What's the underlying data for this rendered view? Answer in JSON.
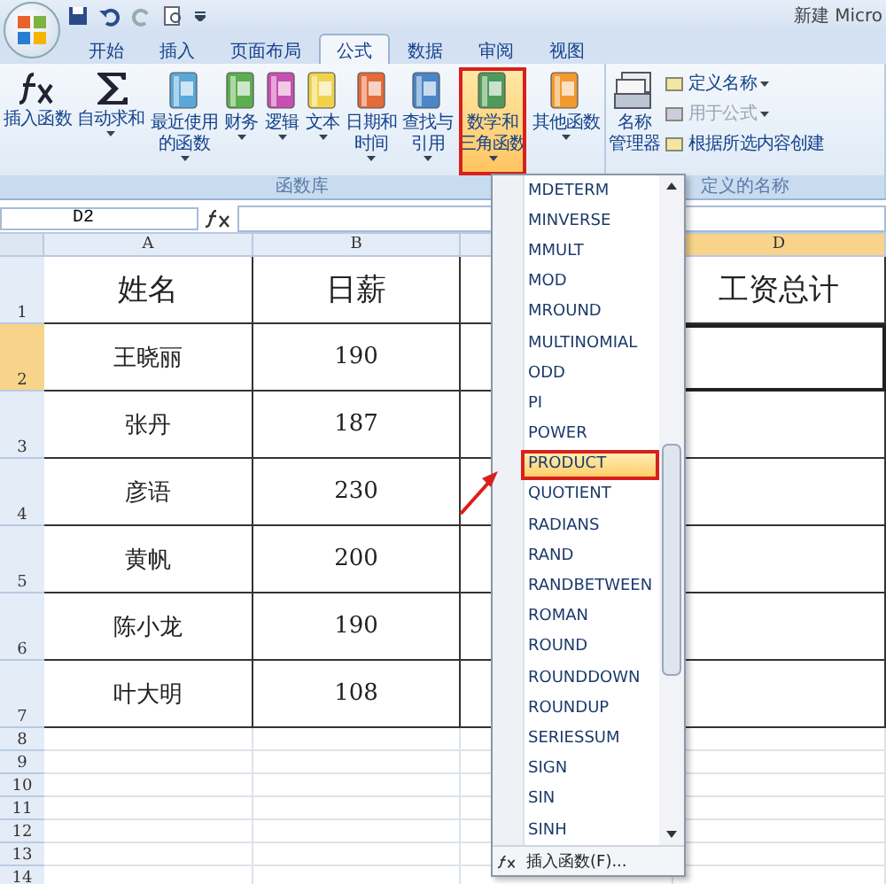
{
  "window": {
    "title": "新建 Micro"
  },
  "tabs": [
    {
      "label": "开始",
      "selected": false
    },
    {
      "label": "插入",
      "selected": false
    },
    {
      "label": "页面布局",
      "selected": false
    },
    {
      "label": "公式",
      "selected": true
    },
    {
      "label": "数据",
      "selected": false
    },
    {
      "label": "审阅",
      "selected": false
    },
    {
      "label": "视图",
      "selected": false
    }
  ],
  "ribbon": {
    "groups": [
      {
        "label": "函数库",
        "buttons": [
          {
            "kind": "fx",
            "lines": [
              "插入函数"
            ],
            "dropdown": false,
            "selected": false
          },
          {
            "kind": "sigma",
            "lines": [
              "自动求和"
            ],
            "dropdown": true,
            "selected": false
          },
          {
            "kind": "book",
            "color": "#5aa8d8",
            "lines": [
              "最近使用",
              "的函数"
            ],
            "dropdown": true,
            "selected": false
          },
          {
            "kind": "book",
            "color": "#5cae4e",
            "lines": [
              "财务"
            ],
            "dropdown": true,
            "selected": false
          },
          {
            "kind": "book",
            "color": "#c84fb0",
            "lines": [
              "逻辑"
            ],
            "dropdown": true,
            "selected": false
          },
          {
            "kind": "book",
            "color": "#f0d34a",
            "lines": [
              "文本"
            ],
            "dropdown": true,
            "selected": false
          },
          {
            "kind": "book",
            "color": "#e46a3a",
            "lines": [
              "日期和",
              "时间"
            ],
            "dropdown": true,
            "selected": false
          },
          {
            "kind": "book",
            "color": "#4a86c8",
            "lines": [
              "查找与",
              "引用"
            ],
            "dropdown": true,
            "selected": false
          },
          {
            "kind": "book",
            "color": "#4f9a5a",
            "lines": [
              "数学和",
              "三角函数"
            ],
            "dropdown": true,
            "selected": true
          },
          {
            "kind": "book",
            "color": "#f09a30",
            "lines": [
              "其他函数"
            ],
            "dropdown": true,
            "selected": false
          }
        ]
      },
      {
        "label": "定义的名称",
        "buttons": [
          {
            "kind": "cards",
            "lines": [
              "名称",
              "管理器"
            ],
            "dropdown": false,
            "selected": false
          }
        ],
        "small": [
          {
            "label": "定义名称",
            "dropdown": true,
            "disabled": false
          },
          {
            "label": "用于公式",
            "dropdown": true,
            "disabled": true
          },
          {
            "label": "根据所选内容创建",
            "dropdown": false,
            "disabled": false
          }
        ]
      }
    ]
  },
  "formula_bar": {
    "name_box": "D2"
  },
  "sheet": {
    "columns": [
      {
        "label": "A",
        "selected": false
      },
      {
        "label": "B",
        "selected": false
      },
      {
        "selected": false
      },
      {
        "label": "D",
        "selected": true
      }
    ],
    "rows": [
      {
        "number": "1",
        "selected": false,
        "cells": [
          "姓名",
          "日薪",
          "",
          "工资总计"
        ]
      },
      {
        "number": "2",
        "selected": true,
        "cells": [
          "王晓丽",
          "190",
          "",
          ""
        ]
      },
      {
        "number": "3",
        "selected": false,
        "cells": [
          "张丹",
          "187",
          "",
          ""
        ]
      },
      {
        "number": "4",
        "selected": false,
        "cells": [
          "彦语",
          "230",
          "",
          ""
        ]
      },
      {
        "number": "5",
        "selected": false,
        "cells": [
          "黄帆",
          "200",
          "",
          ""
        ]
      },
      {
        "number": "6",
        "selected": false,
        "cells": [
          "陈小龙",
          "190",
          "",
          ""
        ]
      },
      {
        "number": "7",
        "selected": false,
        "cells": [
          "叶大明",
          "108",
          "",
          ""
        ]
      },
      {
        "number": "8",
        "selected": false,
        "cells": []
      },
      {
        "number": "9",
        "selected": false,
        "cells": []
      },
      {
        "number": "10",
        "selected": false,
        "cells": []
      },
      {
        "number": "11",
        "selected": false,
        "cells": []
      },
      {
        "number": "12",
        "selected": false,
        "cells": []
      },
      {
        "number": "13",
        "selected": false,
        "cells": []
      },
      {
        "number": "14",
        "selected": false,
        "cells": []
      }
    ]
  },
  "function_menu": {
    "items": [
      {
        "label": "MDETERM",
        "selected": false
      },
      {
        "label": "MINVERSE",
        "selected": false
      },
      {
        "label": "MMULT",
        "selected": false
      },
      {
        "label": "MOD",
        "selected": false
      },
      {
        "label": "MROUND",
        "selected": false
      },
      {
        "label": "MULTINOMIAL",
        "selected": false
      },
      {
        "label": "ODD",
        "selected": false
      },
      {
        "label": "PI",
        "selected": false
      },
      {
        "label": "POWER",
        "selected": false
      },
      {
        "label": "PRODUCT",
        "selected": true
      },
      {
        "label": "QUOTIENT",
        "selected": false
      },
      {
        "label": "RADIANS",
        "selected": false
      },
      {
        "label": "RAND",
        "selected": false
      },
      {
        "label": "RANDBETWEEN",
        "selected": false
      },
      {
        "label": "ROMAN",
        "selected": false
      },
      {
        "label": "ROUND",
        "selected": false
      },
      {
        "label": "ROUNDDOWN",
        "selected": false
      },
      {
        "label": "ROUNDUP",
        "selected": false
      },
      {
        "label": "SERIESSUM",
        "selected": false
      },
      {
        "label": "SIGN",
        "selected": false
      },
      {
        "label": "SIN",
        "selected": false
      },
      {
        "label": "SINH",
        "selected": false
      }
    ],
    "footer": "插入函数(F)..."
  }
}
